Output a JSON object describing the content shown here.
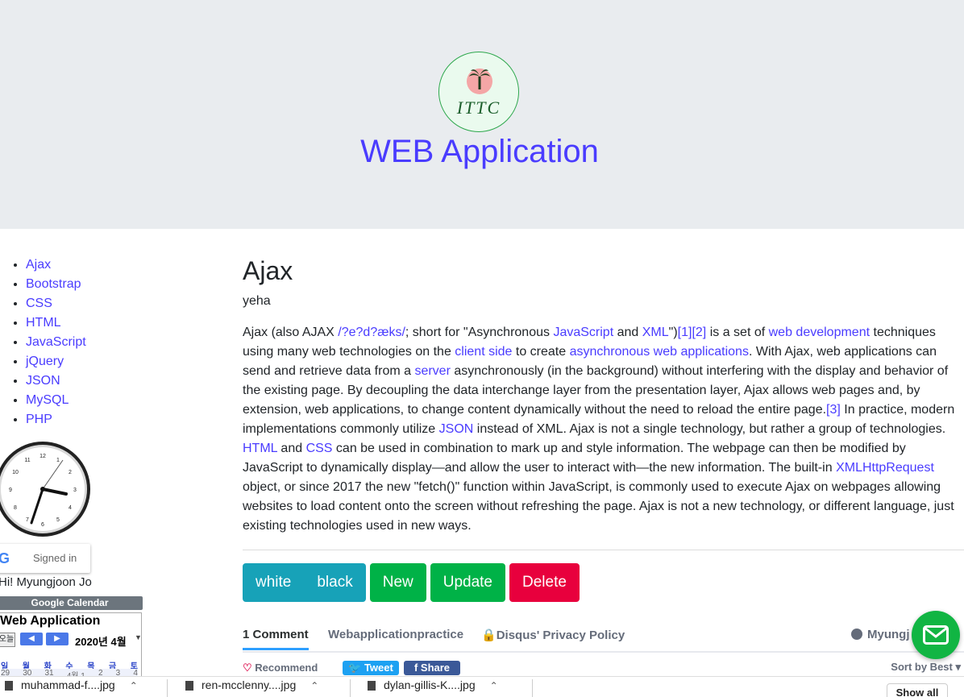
{
  "header": {
    "logo_text": "ITTC",
    "site_title": "WEB Application"
  },
  "sidebar": {
    "items": [
      {
        "label": "Ajax"
      },
      {
        "label": "Bootstrap"
      },
      {
        "label": "CSS"
      },
      {
        "label": "HTML"
      },
      {
        "label": "JavaScript"
      },
      {
        "label": "jQuery"
      },
      {
        "label": "JSON"
      },
      {
        "label": "MySQL"
      },
      {
        "label": "PHP"
      }
    ]
  },
  "clock": {
    "time": "1:04",
    "numbers": [
      "12",
      "1",
      "2",
      "3",
      "4",
      "5",
      "6",
      "7",
      "8",
      "9",
      "10",
      "11"
    ]
  },
  "google_signin": {
    "icon_letter": "G",
    "label": "Signed in"
  },
  "greeting": "Hi! Myungjoon Jo",
  "calendar": {
    "header": "Google Calendar",
    "title": "Web Application",
    "today_btn": "오늘",
    "prev_icon": "◀",
    "next_icon": "▶",
    "month": "2020년 4월",
    "dropdown_icon": "▼",
    "weekdays": [
      "일",
      "월",
      "화",
      "수",
      "목",
      "금",
      "토"
    ],
    "days": [
      "29",
      "30",
      "31",
      "4월 1",
      "2",
      "3",
      "4"
    ]
  },
  "article": {
    "title": "Ajax",
    "subtitle": "yeha",
    "parts": {
      "p1": "Ajax (also AJAX ",
      "l1": "/?e?d?æks/",
      "p2": "; short for \"Asynchronous ",
      "l2": "JavaScript",
      "p3": " and ",
      "l3": "XML",
      "p4": "\")",
      "l4": "[1]",
      "l5": "[2]",
      "p5": " is a set of ",
      "l6": "web development",
      "p6": " techniques using many web technologies on the ",
      "l7": "client side",
      "p7": " to create ",
      "l8": "asynchronous web applications",
      "p8": ". With Ajax, web applications can send and retrieve data from a ",
      "l9": "server",
      "p9": " asynchronously (in the background) without interfering with the display and behavior of the existing page. By decoupling the data interchange layer from the presentation layer, Ajax allows web pages and, by extension, web applications, to change content dynamically without the need to reload the entire page.",
      "l10": "[3]",
      "p10": " In practice, modern implementations commonly utilize ",
      "l11": "JSON",
      "p11": " instead of XML. Ajax is not a single technology, but rather a group of technologies. ",
      "l12": "HTML",
      "p12": " and ",
      "l13": "CSS",
      "p13": " can be used in combination to mark up and style information. The webpage can then be modified by JavaScript to dynamically display—and allow the user to interact with—the new information. The built-in ",
      "l14": "XMLHttpRequest",
      "p14": " object, or since 2017 the new \"fetch()\" function within JavaScript, is commonly used to execute Ajax on webpages allowing websites to load content onto the screen without refreshing the page. Ajax is not a new technology, or different language, just existing technologies used in new ways."
    }
  },
  "buttons": {
    "white": "white",
    "black": "black",
    "new": "New",
    "update": "Update",
    "delete": "Delete"
  },
  "disqus": {
    "comments": "1 Comment",
    "forum": "Webapplicationpractice",
    "privacy": "Disqus' Privacy Policy",
    "user": "Myungj",
    "recommend": "Recommend",
    "tweet": "Tweet",
    "share": "Share",
    "sort": "Sort by Best"
  },
  "downloads": {
    "items": [
      "muhammad-f....jpg",
      "ren-mcclenny....jpg",
      "dylan-gillis-K....jpg"
    ],
    "show_all": "Show all"
  },
  "colors": {
    "link": "#4a3cff",
    "info": "#17a2b8",
    "success": "#00b247",
    "danger": "#e8003d",
    "jumbotron": "#e9ecef"
  }
}
